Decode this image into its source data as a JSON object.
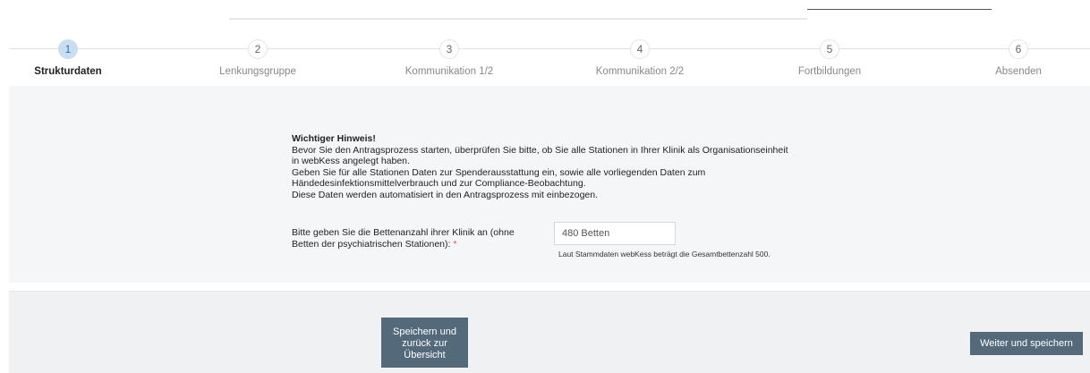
{
  "steps": [
    {
      "number": "1",
      "label": "Strukturdaten",
      "active": true
    },
    {
      "number": "2",
      "label": "Lenkungsgruppe",
      "active": false
    },
    {
      "number": "3",
      "label": "Kommunikation 1/2",
      "active": false
    },
    {
      "number": "4",
      "label": "Kommunikation 2/2",
      "active": false
    },
    {
      "number": "5",
      "label": "Fortbildungen",
      "active": false
    },
    {
      "number": "6",
      "label": "Absenden",
      "active": false
    }
  ],
  "notice": {
    "title": "Wichtiger Hinweis!",
    "line1": "Bevor Sie den Antragsprozess starten, überprüfen Sie bitte, ob Sie alle Stationen in Ihrer Klinik als Organisationseinheit",
    "line2": "in webKess angelegt haben.",
    "line3": "Geben Sie für alle Stationen Daten zur Spenderausstattung ein, sowie alle vorliegenden Daten zum",
    "line4": "Händedesinfektionsmittelverbrauch und zur Compliance-Beobachtung.",
    "line5": "Diese Daten werden automatisiert in den Antragsprozess mit einbezogen."
  },
  "beds_field": {
    "label_line1": "Bitte geben Sie die Bettenanzahl ihrer Klinik an (ohne",
    "label_line2": "Betten der psychiatrischen Stationen):",
    "required_marker": "*",
    "value": "480 Betten",
    "hint": "Laut Stammdaten webKess beträgt die Gesamtbettenzahl 500."
  },
  "buttons": {
    "save_back_line1": "Speichern und",
    "save_back_line2": "zurück zur",
    "save_back_line3": "Übersicht",
    "next": "Weiter und speichern"
  },
  "colors": {
    "active_step": "#c9def2",
    "button": "#546a7a",
    "panel": "#f5f6f7",
    "required": "#d9534f"
  }
}
